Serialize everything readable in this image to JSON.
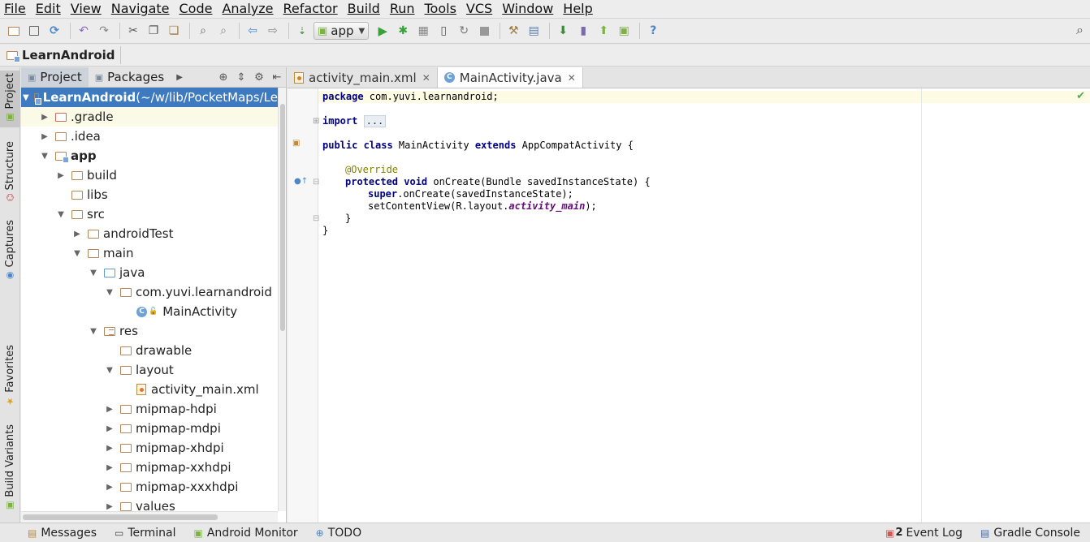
{
  "menu": [
    "File",
    "Edit",
    "View",
    "Navigate",
    "Code",
    "Analyze",
    "Refactor",
    "Build",
    "Run",
    "Tools",
    "VCS",
    "Window",
    "Help"
  ],
  "toolbar": {
    "run_config": "app",
    "icons": [
      "open-icon",
      "save-icon",
      "sync-icon",
      "undo-icon",
      "redo-icon",
      "cut-icon",
      "copy-icon",
      "paste-icon",
      "find-icon",
      "replace-icon",
      "back-icon",
      "forward-icon",
      "make-icon",
      "run-icon",
      "debug-icon",
      "coverage-icon",
      "attach-icon",
      "rerun-icon",
      "stop-icon",
      "settings-icon",
      "structure-icon",
      "sdk-manager-icon",
      "avd-manager-icon",
      "sync-gradle-icon",
      "android-monitor-icon",
      "help-icon"
    ]
  },
  "navbar": {
    "crumb": "LearnAndroid"
  },
  "left_stripe": {
    "tabs": [
      "Project",
      "Structure",
      "Captures",
      "Favorites",
      "Build Variants"
    ]
  },
  "project_panel": {
    "tabs": [
      "Project",
      "Packages"
    ],
    "tree": [
      {
        "label": "LearnAndroid",
        "suffix": " (~/w/lib/PocketMaps/Le",
        "depth": 0,
        "arrow": "down",
        "icon": "mod",
        "selected": true,
        "bold": true
      },
      {
        "label": ".gradle",
        "depth": 1,
        "arrow": "right",
        "icon": "red",
        "highlight": true
      },
      {
        "label": ".idea",
        "depth": 1,
        "arrow": "right",
        "icon": "plain"
      },
      {
        "label": "app",
        "depth": 1,
        "arrow": "down",
        "icon": "mod",
        "bold": true
      },
      {
        "label": "build",
        "depth": 2,
        "arrow": "right",
        "icon": "plain"
      },
      {
        "label": "libs",
        "depth": 2,
        "arrow": "none",
        "icon": "plain"
      },
      {
        "label": "src",
        "depth": 2,
        "arrow": "down",
        "icon": "plain"
      },
      {
        "label": "androidTest",
        "depth": 3,
        "arrow": "right",
        "icon": "plain"
      },
      {
        "label": "main",
        "depth": 3,
        "arrow": "down",
        "icon": "plain"
      },
      {
        "label": "java",
        "depth": 4,
        "arrow": "down",
        "icon": "blue"
      },
      {
        "label": "com.yuvi.learnandroid",
        "depth": 5,
        "arrow": "down",
        "icon": "plain"
      },
      {
        "label": "MainActivity",
        "depth": 6,
        "arrow": "none",
        "icon": "class"
      },
      {
        "label": "res",
        "depth": 4,
        "arrow": "down",
        "icon": "res"
      },
      {
        "label": "drawable",
        "depth": 5,
        "arrow": "none",
        "icon": "plain"
      },
      {
        "label": "layout",
        "depth": 5,
        "arrow": "down",
        "icon": "plain"
      },
      {
        "label": "activity_main.xml",
        "depth": 6,
        "arrow": "none",
        "icon": "xml"
      },
      {
        "label": "mipmap-hdpi",
        "depth": 5,
        "arrow": "right",
        "icon": "plain"
      },
      {
        "label": "mipmap-mdpi",
        "depth": 5,
        "arrow": "right",
        "icon": "plain"
      },
      {
        "label": "mipmap-xhdpi",
        "depth": 5,
        "arrow": "right",
        "icon": "plain"
      },
      {
        "label": "mipmap-xxhdpi",
        "depth": 5,
        "arrow": "right",
        "icon": "plain"
      },
      {
        "label": "mipmap-xxxhdpi",
        "depth": 5,
        "arrow": "right",
        "icon": "plain"
      },
      {
        "label": "values",
        "depth": 5,
        "arrow": "right",
        "icon": "plain"
      }
    ]
  },
  "editor": {
    "tabs": [
      {
        "label": "activity_main.xml",
        "active": false,
        "icon": "xml"
      },
      {
        "label": "MainActivity.java",
        "active": true,
        "icon": "class"
      }
    ],
    "code": {
      "l1_kw": "package",
      "l1_rest": " com.yuvi.learnandroid;",
      "l2_kw": "import",
      "l2_fold": "...",
      "l3_kw": "public class",
      "l3_mid": " MainActivity ",
      "l3_kw2": "extends",
      "l3_rest": " AppCompatActivity {",
      "l4_ann": "@Override",
      "l5_kw": "protected void",
      "l5_rest": " onCreate(Bundle savedInstanceState) {",
      "l6_kw": "super",
      "l6_rest": ".onCreate(savedInstanceState);",
      "l7_pre": "setContentView(R.layout.",
      "l7_fld": "activity_main",
      "l7_post": ");",
      "l8": "}",
      "l9": "}"
    }
  },
  "bottom": {
    "tools": [
      "Messages",
      "Terminal",
      "Android Monitor",
      "TODO"
    ],
    "right": [
      "Event Log",
      "Gradle Console"
    ],
    "event_count": "2"
  },
  "colors": {
    "selection": "#3d7ac0",
    "keyword": "#000080",
    "annotation": "#808000",
    "field": "#660e7a"
  }
}
